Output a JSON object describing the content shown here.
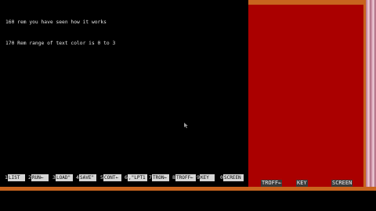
{
  "listing": {
    "lines": [
      "160 rem you have seen how it works",
      "170 Rem range of text color is 0 to 3"
    ]
  },
  "function_keys": [
    {
      "num": "1",
      "label": "LIST"
    },
    {
      "num": "2",
      "label": "RUN←"
    },
    {
      "num": "3",
      "label": "LOAD\""
    },
    {
      "num": "4",
      "label": "SAVE\""
    },
    {
      "num": "5",
      "label": "CONT←"
    },
    {
      "num": "6",
      "label": ",\"LPT1"
    },
    {
      "num": "7",
      "label": "TRON←"
    },
    {
      "num": "8",
      "label": "TROFF←"
    },
    {
      "num": "9",
      "label": "KEY"
    },
    {
      "num": "0",
      "label": "SCREEN"
    }
  ],
  "right_keys": [
    {
      "label": "TROFF←"
    },
    {
      "label": "KEY"
    },
    {
      "label": "SCREEN"
    }
  ],
  "colors": {
    "background": "#000000",
    "red_block": "#aa0000",
    "border": "#c8641e"
  },
  "icons": {
    "pointer": "mouse-pointer-icon"
  }
}
